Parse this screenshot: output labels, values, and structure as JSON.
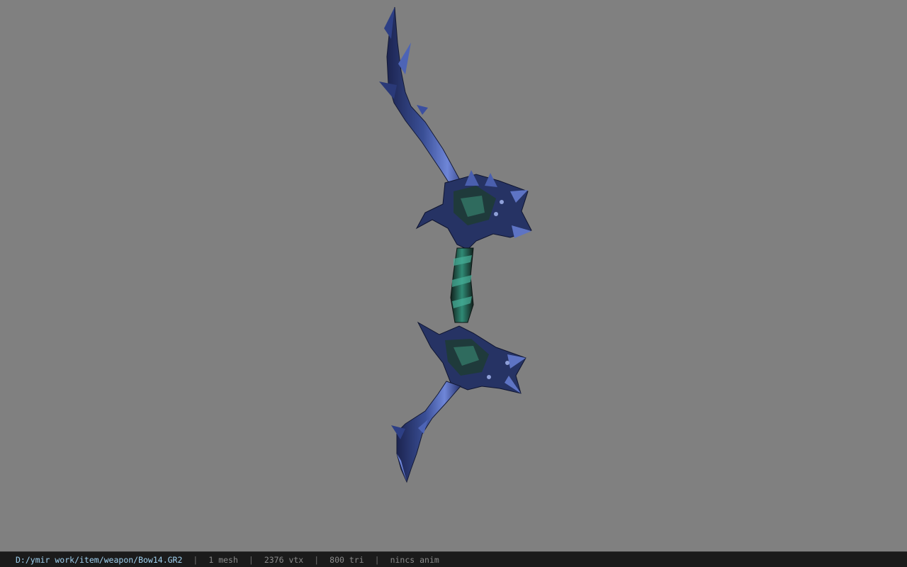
{
  "viewer": {
    "background_color": "#808080",
    "model_name": "Bow14",
    "model_colors": {
      "limb_blue": "#3a4f96",
      "limb_highlight": "#6f86d8",
      "limb_dark": "#1c2450",
      "grip_teal": "#2f8a75",
      "grip_dark": "#12201c"
    }
  },
  "status": {
    "path": "D:/ymir work/item/weapon/Bow14.GR2",
    "mesh": "1 mesh",
    "vtx": "2376 vtx",
    "tri": "800 tri",
    "anim": "nincs anim",
    "separator": "|"
  }
}
